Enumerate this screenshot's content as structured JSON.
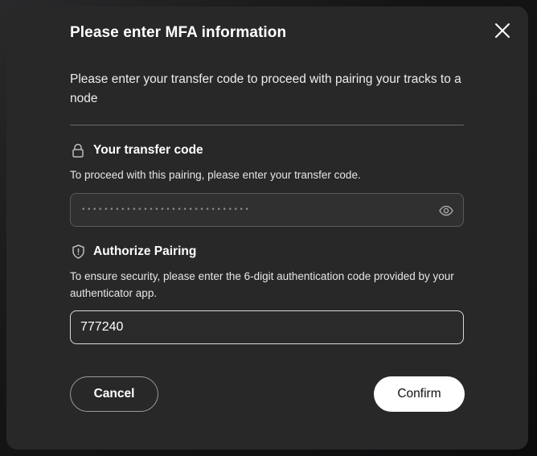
{
  "dialog": {
    "title": "Please enter MFA information",
    "intro": "Please enter your transfer code to proceed with pairing your tracks to a node"
  },
  "transfer_code": {
    "title": "Your transfer code",
    "description": "To proceed with this pairing, please enter your transfer code.",
    "masked_value": "••••••••••••••••••••••••••••••",
    "icon": "lock-icon",
    "toggle_icon": "eye-icon"
  },
  "authorize": {
    "title": "Authorize Pairing",
    "description": "To ensure security, please enter the 6-digit authentication code provided by your authenticator app.",
    "value": "777240",
    "icon": "shield-icon"
  },
  "actions": {
    "cancel_label": "Cancel",
    "confirm_label": "Confirm"
  },
  "colors": {
    "modal_bg": "#282828",
    "confirm_bg": "#ffffff"
  }
}
